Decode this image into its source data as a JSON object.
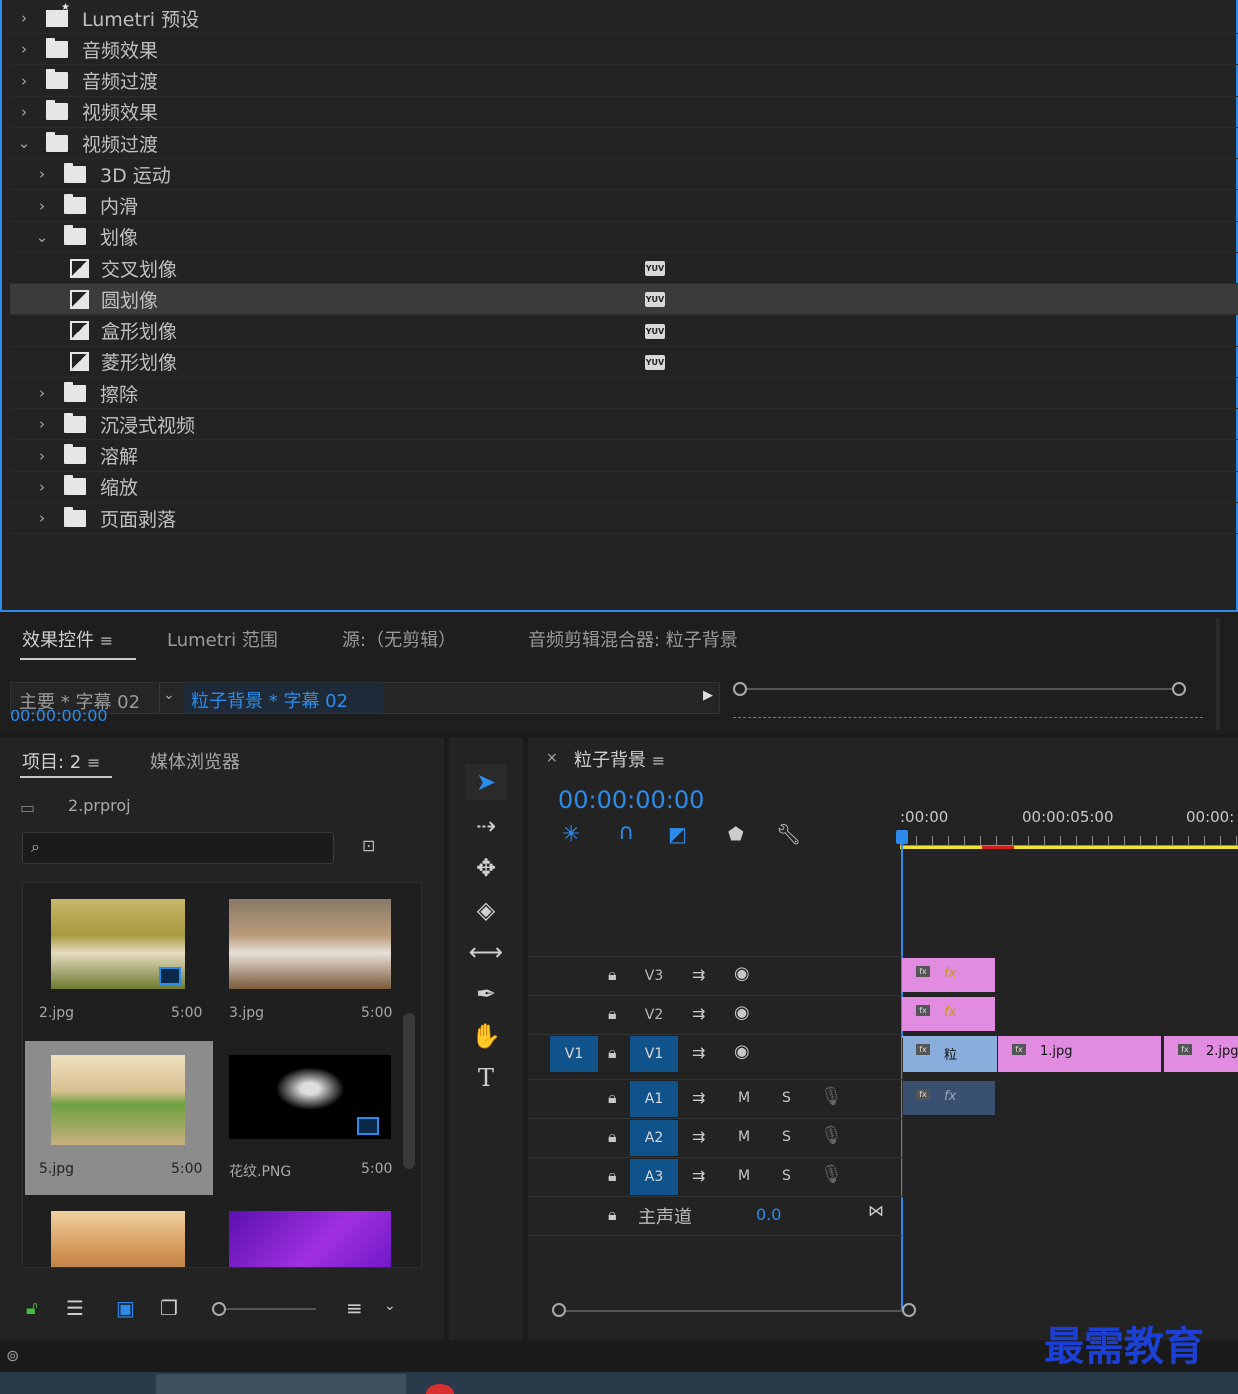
{
  "effects_tree": [
    {
      "label": "Lumetri 预设",
      "type": "preset",
      "indent": 0,
      "expanded": false
    },
    {
      "label": "音频效果",
      "type": "folder",
      "indent": 0,
      "expanded": false
    },
    {
      "label": "音频过渡",
      "type": "folder",
      "indent": 0,
      "expanded": false
    },
    {
      "label": "视频效果",
      "type": "folder",
      "indent": 0,
      "expanded": false
    },
    {
      "label": "视频过渡",
      "type": "folder",
      "indent": 0,
      "expanded": true
    },
    {
      "label": "3D 运动",
      "type": "folder",
      "indent": 1,
      "expanded": false
    },
    {
      "label": "内滑",
      "type": "folder",
      "indent": 1,
      "expanded": false
    },
    {
      "label": "划像",
      "type": "folder",
      "indent": 1,
      "expanded": true
    },
    {
      "label": "交叉划像",
      "type": "effect",
      "indent": 2,
      "badge": "YUV"
    },
    {
      "label": "圆划像",
      "type": "effect",
      "indent": 2,
      "badge": "YUV",
      "selected": true
    },
    {
      "label": "盒形划像",
      "type": "effect",
      "indent": 2,
      "badge": "YUV"
    },
    {
      "label": "菱形划像",
      "type": "effect",
      "indent": 2,
      "badge": "YUV"
    },
    {
      "label": "擦除",
      "type": "folder",
      "indent": 1,
      "expanded": false
    },
    {
      "label": "沉浸式视频",
      "type": "folder",
      "indent": 1,
      "expanded": false
    },
    {
      "label": "溶解",
      "type": "folder",
      "indent": 1,
      "expanded": false
    },
    {
      "label": "缩放",
      "type": "folder",
      "indent": 1,
      "expanded": false
    },
    {
      "label": "页面剥落",
      "type": "folder",
      "indent": 1,
      "expanded": false
    }
  ],
  "panel_tabs": {
    "effect_controls": "效果控件",
    "lumetri_scopes": "Lumetri 范围",
    "source": "源:（无剪辑）",
    "audio_mixer": "音频剪辑混合器: 粒子背景"
  },
  "clip_bar": {
    "master": "主要 * 字幕 02",
    "sequence": "粒子背景 * 字幕 02",
    "timecode": "00:00:00:00"
  },
  "project": {
    "tab": "项目: 2",
    "media_browser": "媒体浏览器",
    "file": "2.prproj",
    "items": [
      {
        "name": "2.jpg",
        "duration": "5:00"
      },
      {
        "name": "3.jpg",
        "duration": "5:00"
      },
      {
        "name": "5.jpg",
        "duration": "5:00",
        "selected": true
      },
      {
        "name": "花纹.PNG",
        "duration": "5:00"
      },
      {
        "name": "",
        "duration": ""
      },
      {
        "name": "",
        "duration": ""
      }
    ]
  },
  "timeline": {
    "title": "粒子背景",
    "timecode": "00:00:00:00",
    "ruler": [
      ":00:00",
      "00:00:05:00",
      "00:00:"
    ],
    "tracks": [
      {
        "id": "V3",
        "kind": "video"
      },
      {
        "id": "V2",
        "kind": "video"
      },
      {
        "id": "V1",
        "kind": "video",
        "source": "V1"
      },
      {
        "id": "A1",
        "kind": "audio",
        "m": "M",
        "s": "S"
      },
      {
        "id": "A2",
        "kind": "audio",
        "m": "M",
        "s": "S"
      },
      {
        "id": "A3",
        "kind": "audio",
        "m": "M",
        "s": "S"
      }
    ],
    "master": {
      "label": "主声道",
      "value": "0.0"
    },
    "clips": {
      "v3": "fx",
      "v2": "fx",
      "v1a": "粒",
      "v1b": "1.jpg",
      "v1c": "2.jpg",
      "a1": "fx"
    }
  },
  "watermark": "最需教育",
  "colors": {
    "accent": "#2d8ceb",
    "timecode": "#2d8ceb",
    "clip_pink": "#e18ce1",
    "clip_blue": "#8aaedc"
  }
}
